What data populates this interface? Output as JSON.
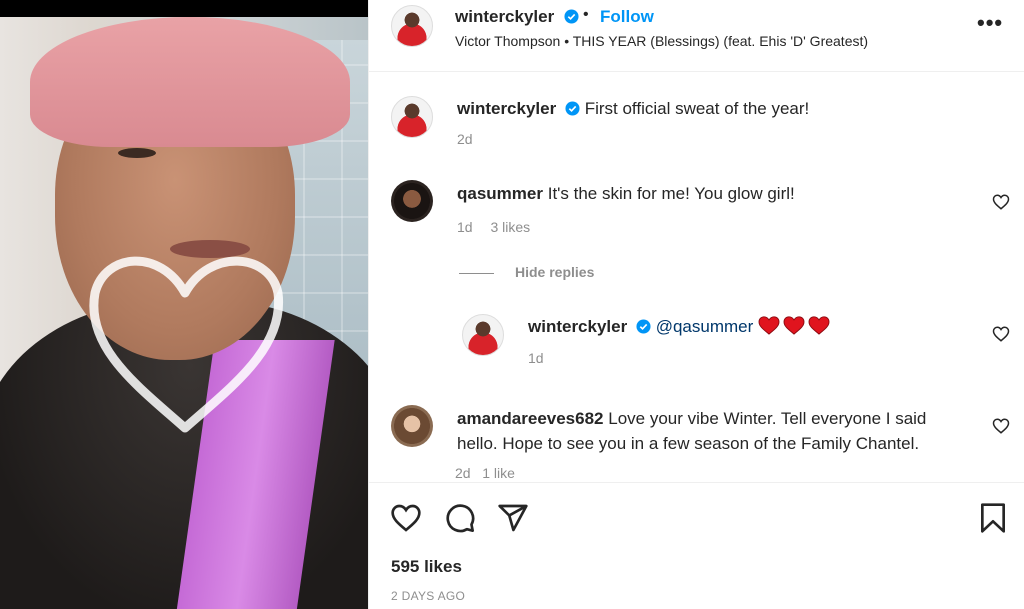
{
  "post": {
    "username": "winterckyler",
    "follow_label": "Follow",
    "separator": "•",
    "song": "Victor Thompson • THIS YEAR (Blessings) (feat. Ehis 'D' Greatest)",
    "more_label": "•••"
  },
  "caption": {
    "username": "winterckyler",
    "text": "First official sweat of the year!",
    "time": "2d"
  },
  "comments": [
    {
      "username": "qasummer",
      "text": "It's the skin for me! You glow girl!",
      "time": "1d",
      "likes": "3 likes"
    }
  ],
  "replies_toggle": "Hide replies",
  "reply": {
    "username": "winterckyler",
    "mention": "@qasummer",
    "time": "1d"
  },
  "comment2": {
    "username": "amandareeves682",
    "line1": "Love your vibe Winter. Tell everyone I said",
    "line2": "hello. Hope to see you in a few season of the Family Chantel.",
    "meta_partial": "2d   1 like"
  },
  "footer": {
    "likes": "595 likes",
    "ago": "2 DAYS AGO"
  },
  "colors": {
    "accent": "#0095f6",
    "text": "#262626",
    "muted": "#8e8e8e",
    "heart": "#ed4956"
  },
  "icons": [
    "verified-badge-icon",
    "more-options-icon",
    "like-heart-icon",
    "comment-icon",
    "share-icon",
    "bookmark-icon",
    "red-heart-emoji-icon"
  ]
}
